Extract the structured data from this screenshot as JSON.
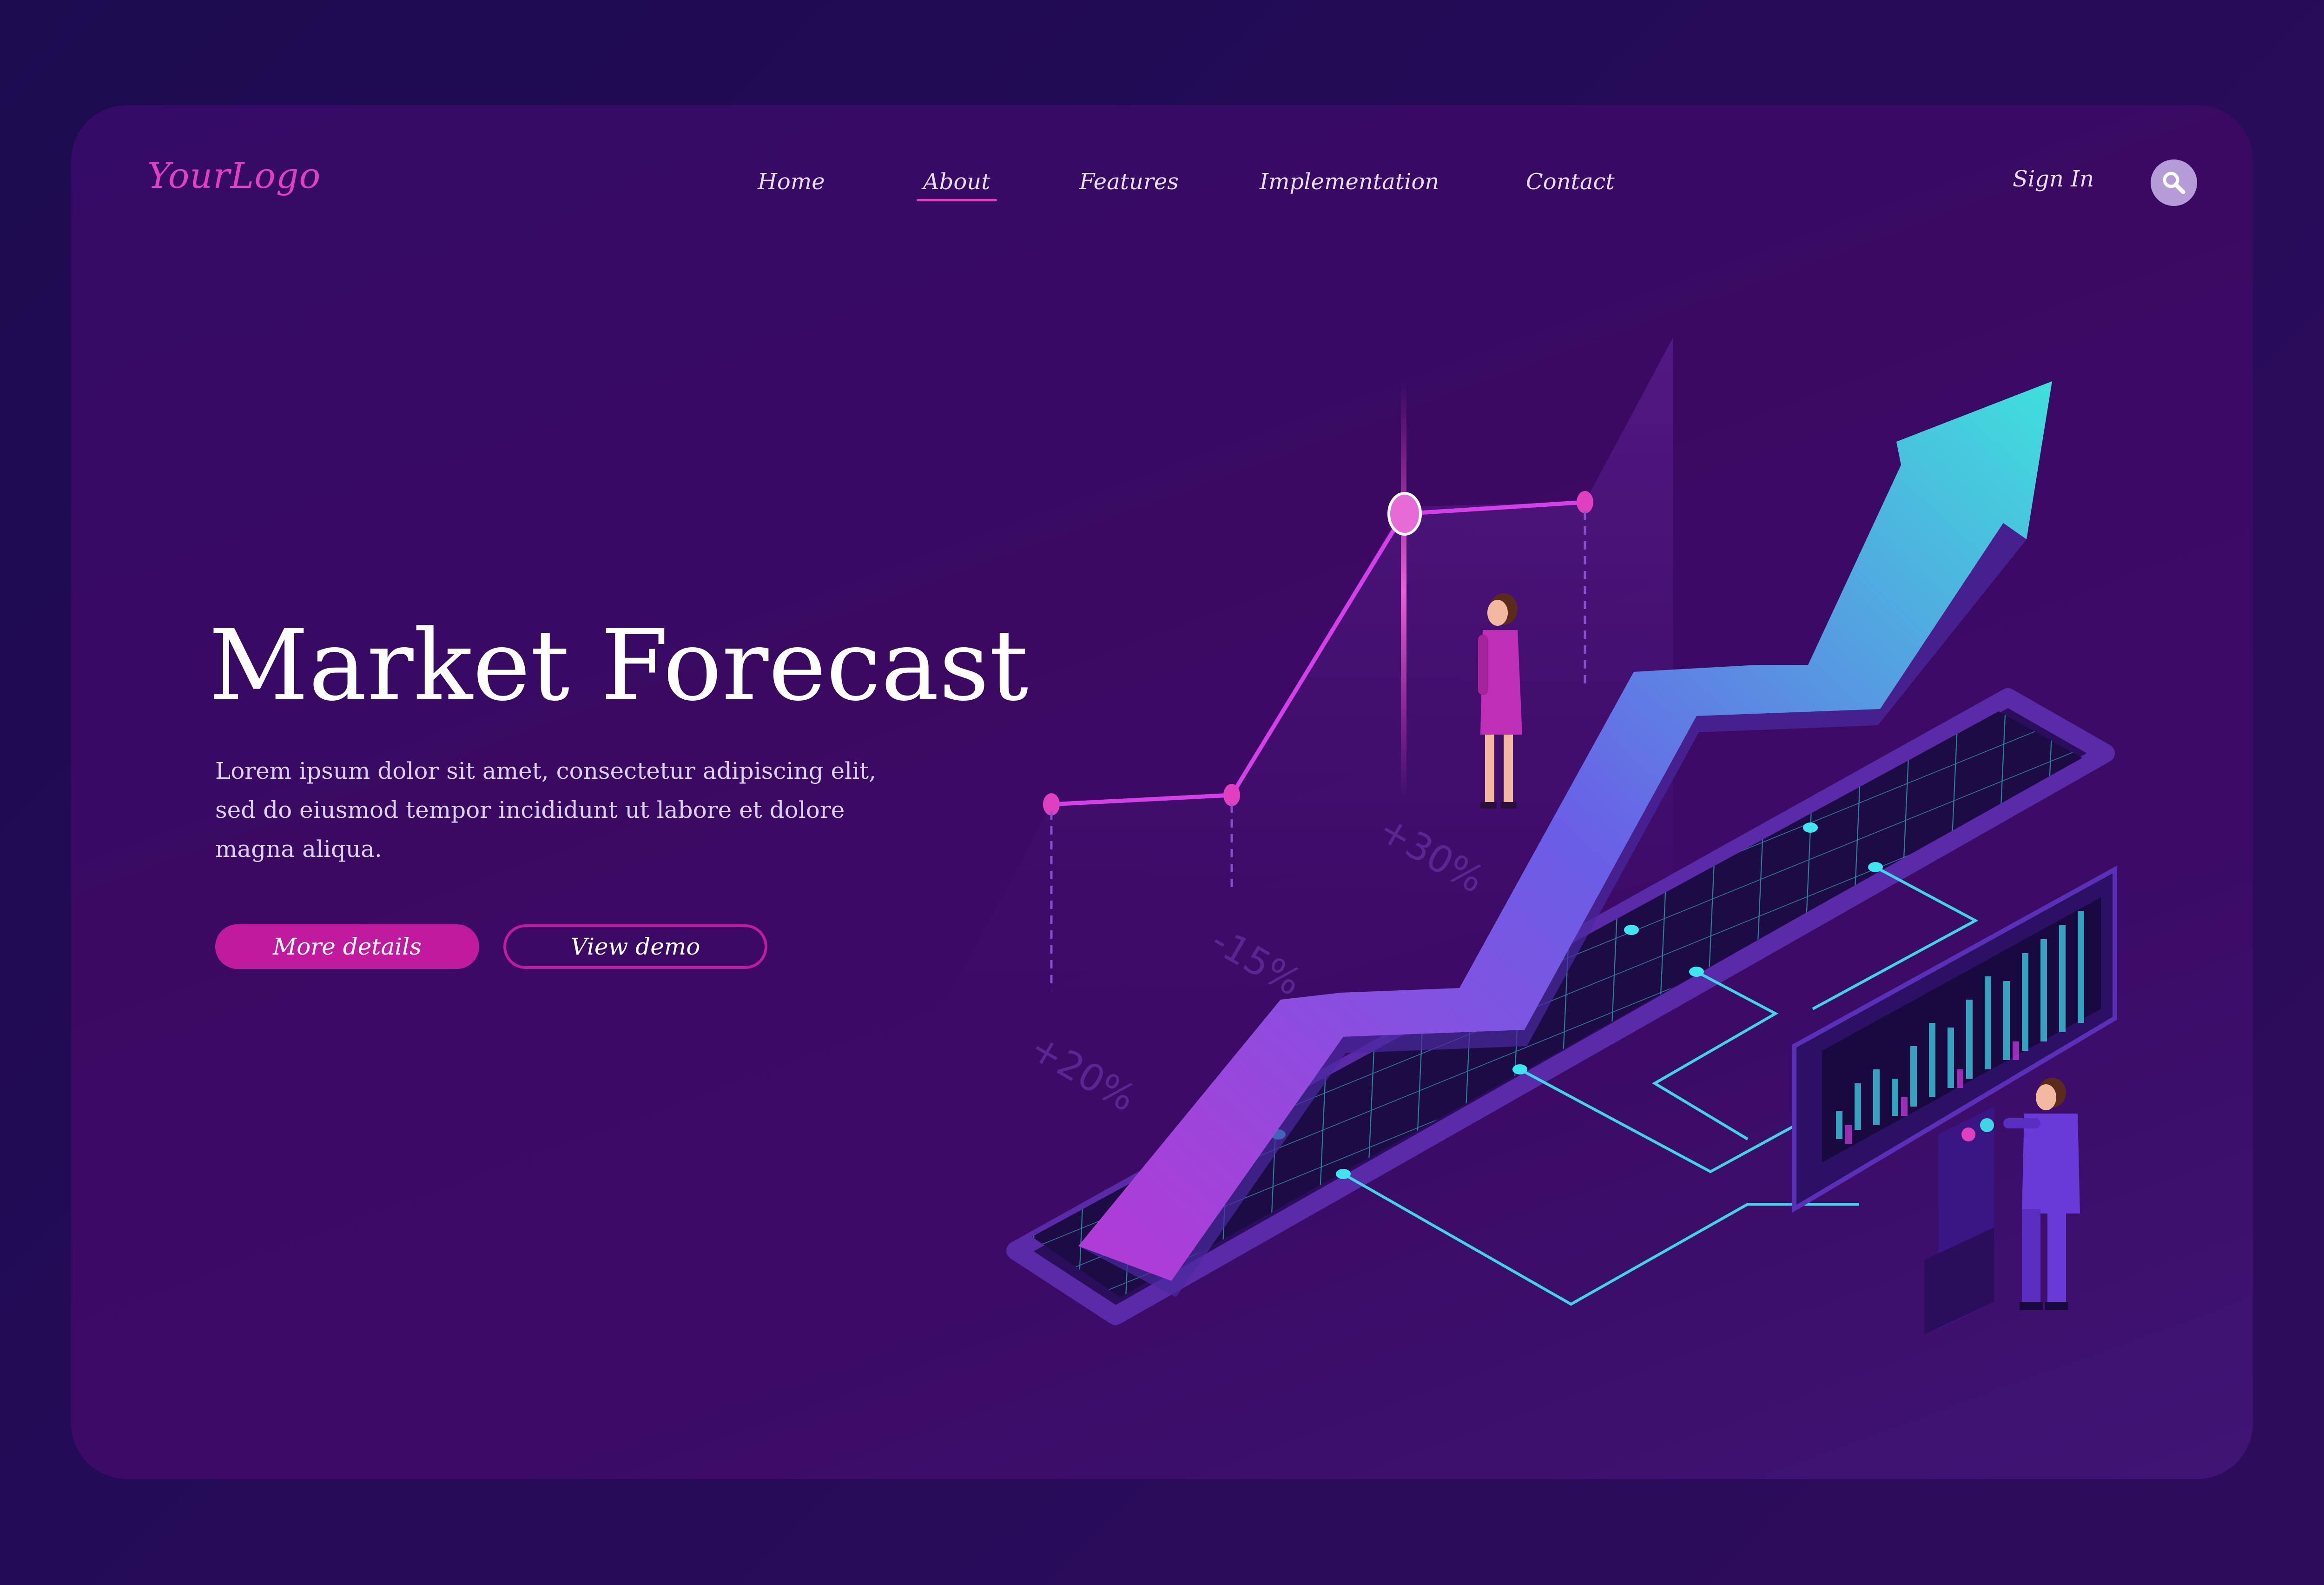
{
  "header": {
    "logo": "YourLogo",
    "nav": [
      {
        "label": "Home",
        "active": false
      },
      {
        "label": "About",
        "active": true
      },
      {
        "label": "Features",
        "active": false
      },
      {
        "label": "Implementation",
        "active": false
      },
      {
        "label": "Contact",
        "active": false
      }
    ],
    "sign_in": "Sign In",
    "search_icon": "search-icon"
  },
  "hero": {
    "title": "Market Forecast",
    "description": "Lorem ipsum dolor sit amet, consectetur adipiscing elit, sed do eiusmod tempor incididunt ut labore et dolore magna aliqua.",
    "primary_button": "More details",
    "secondary_button": "View demo"
  },
  "illustration": {
    "labels": [
      "+20%",
      "-15%",
      "+30%"
    ]
  },
  "colors": {
    "accent": "#e03fc0",
    "button": "#c01a9f",
    "arrow_start": "#b43ad6",
    "arrow_end": "#3fe0dc",
    "grid_line": "#3fd4e6"
  }
}
